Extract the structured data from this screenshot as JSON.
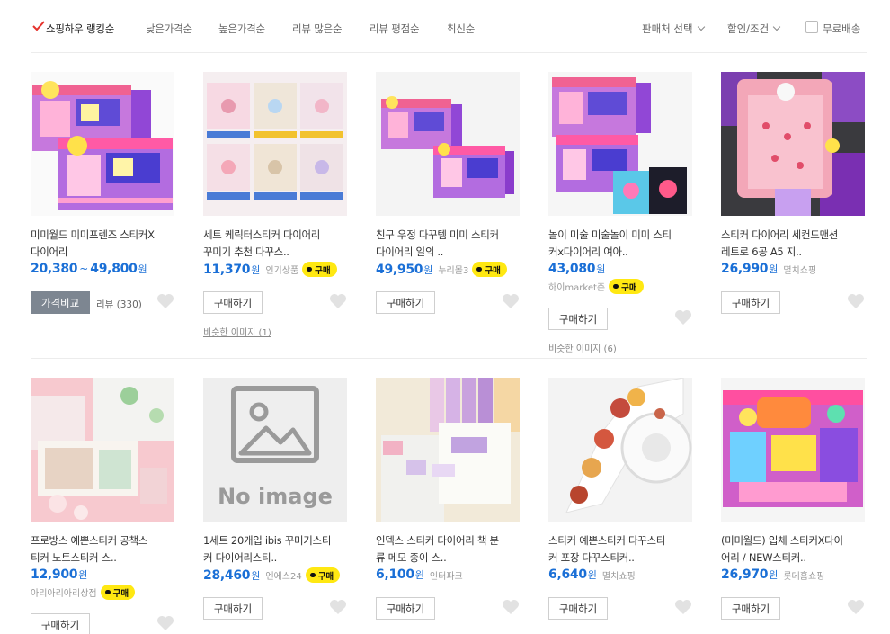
{
  "sort": {
    "options": [
      "쇼핑하우 랭킹순",
      "낮은가격순",
      "높은가격순",
      "리뷰 많은순",
      "리뷰 평점순",
      "최신순"
    ],
    "active_index": 0,
    "check_color": "#e5322c"
  },
  "filters": {
    "seller": "판매처 선택",
    "discount": "할인/조건",
    "free_shipping": "무료배송",
    "free_shipping_checked": false
  },
  "products": [
    {
      "title1": "미미월드 미미프렌즈 스티커X",
      "title2": "다이어리",
      "price": "20,380",
      "price_max": "49,800",
      "won": "원",
      "seller": "",
      "buy": false,
      "button": "가격비교",
      "button_style": "gray",
      "review": "리뷰 (330)",
      "similar": "",
      "image": "mimi-box"
    },
    {
      "title1": "세트 케릭터스티커 다이어리",
      "title2": "꾸미기 추천 다꾸스..",
      "price": "11,370",
      "won": "원",
      "seller": "인기상품",
      "buy": true,
      "button": "구매하기",
      "button_style": "plain",
      "review": "",
      "similar": "비슷한 이미지 (1)",
      "image": "sticker-sheets"
    },
    {
      "title1": "친구 우정 다꾸템 미미 스티커",
      "title2": "다이어리 일의 ..",
      "price": "49,950",
      "won": "원",
      "seller": "누리몰3",
      "buy": true,
      "button": "구매하기",
      "button_style": "plain",
      "review": "",
      "similar": "",
      "image": "mimi-pair"
    },
    {
      "title1": "놀이 미술 미술놀이 미미 스티",
      "title2": "커x다이어리 여아..",
      "price": "43,080",
      "won": "원",
      "seller": "하이market존",
      "buy": true,
      "button": "구매하기",
      "button_style": "plain",
      "review": "",
      "similar": "비슷한 이미지 (6)",
      "image": "mimi-binders",
      "seller_below": true
    },
    {
      "title1": "스티커 다이어리 세컨드맨션",
      "title2": "레트로 6공 A5 지..",
      "price": "26,990",
      "won": "원",
      "seller": "멸치쇼핑",
      "buy": false,
      "button": "구매하기",
      "button_style": "plain",
      "review": "",
      "similar": "",
      "image": "binder-purple"
    },
    {
      "title1": "프로방스 예쁜스티커 공책스",
      "title2": "티커 노트스티커 스..",
      "price": "12,900",
      "won": "원",
      "seller": "아리아리아리상점",
      "buy": true,
      "button": "구매하기",
      "button_style": "plain",
      "review": "",
      "similar": "",
      "image": "pink-stationery",
      "seller_below": true
    },
    {
      "title1": "1세트 20개입 ibis 꾸미기스티",
      "title2": "커 다이어리스티..",
      "price": "28,460",
      "won": "원",
      "seller": "엔에스24",
      "buy": true,
      "button": "구매하기",
      "button_style": "plain",
      "review": "",
      "similar": "",
      "image": "no-image",
      "no_image_text": "No image"
    },
    {
      "title1": "인덱스 스티커 다이어리 책 분",
      "title2": "류 메모 종이 스..",
      "price": "6,100",
      "won": "원",
      "seller": "인터파크",
      "buy": false,
      "button": "구매하기",
      "button_style": "plain",
      "review": "",
      "similar": "",
      "image": "index-tabs"
    },
    {
      "title1": "스티커 예쁜스티커 다꾸스티",
      "title2": "커 포장 다꾸스티커..",
      "price": "6,640",
      "won": "원",
      "seller": "멸치쇼핑",
      "buy": false,
      "button": "구매하기",
      "button_style": "plain",
      "review": "",
      "similar": "",
      "image": "sticker-roll"
    },
    {
      "title1": "(미미월드) 입체 스티커X다이",
      "title2": "어리 / NEW스티커..",
      "price": "26,970",
      "won": "원",
      "seller": "롯데홈쇼핑",
      "buy": false,
      "button": "구매하기",
      "button_style": "plain",
      "review": "",
      "similar": "",
      "image": "mimi-3d"
    }
  ],
  "colors": {
    "price": "#1a6fd6",
    "badge": "#ffe812",
    "compare_button": "#7d8691"
  }
}
